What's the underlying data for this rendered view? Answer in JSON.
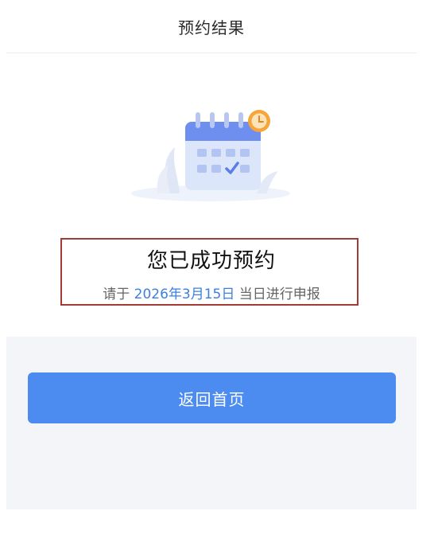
{
  "header": {
    "title": "预约结果"
  },
  "result": {
    "title": "您已成功预约",
    "desc_prefix": "请于",
    "date": "2026年3月15日",
    "desc_suffix": "当日进行申报"
  },
  "actions": {
    "home_label": "返回首页"
  },
  "colors": {
    "accent": "#4c8cf0",
    "date_text": "#3d7fe0",
    "highlight_border": "#a23a36",
    "clock_badge": "#f6a53a"
  },
  "icons": {
    "illustration": "calendar-check-icon",
    "badge": "clock-icon"
  }
}
